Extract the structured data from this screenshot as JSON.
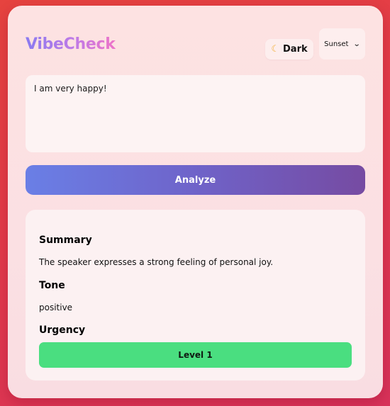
{
  "app": {
    "title": "VibeCheck"
  },
  "header": {
    "theme_toggle_label": "Dark",
    "theme_toggle_icon": "moon-icon",
    "theme_select": {
      "selected": "Sunset",
      "options": [
        "Sunset"
      ]
    }
  },
  "input": {
    "value": "I am very happy!"
  },
  "actions": {
    "analyze_label": "Analyze"
  },
  "results": {
    "summary_heading": "Summary",
    "summary_text": "The speaker expresses a strong feeling of personal joy.",
    "tone_heading": "Tone",
    "tone_text": "positive",
    "urgency_heading": "Urgency",
    "urgency_level": "Level 1"
  },
  "colors": {
    "background": "#e23a4a",
    "analyze_start": "#6a7fe6",
    "analyze_end": "#764ba2",
    "urgency_badge": "#4ade80"
  }
}
